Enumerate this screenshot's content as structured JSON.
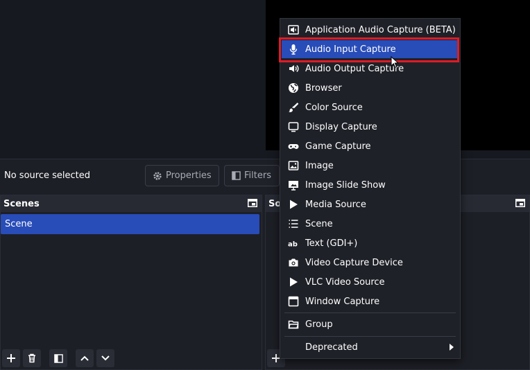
{
  "context_bar": {
    "no_source": "No source selected",
    "properties_label": "Properties",
    "filters_label": "Filters"
  },
  "scenes_dock": {
    "title": "Scenes",
    "items": [
      "Scene"
    ]
  },
  "sources_dock": {
    "title_partial": "So"
  },
  "menu": {
    "items": [
      {
        "label": "Application Audio Capture (BETA)",
        "icon": "app-audio-icon"
      },
      {
        "label": "Audio Input Capture",
        "icon": "microphone-icon",
        "selected": true
      },
      {
        "label": "Audio Output Capture",
        "icon": "speaker-icon"
      },
      {
        "label": "Browser",
        "icon": "globe-icon"
      },
      {
        "label": "Color Source",
        "icon": "paintbrush-icon"
      },
      {
        "label": "Display Capture",
        "icon": "monitor-icon"
      },
      {
        "label": "Game Capture",
        "icon": "gamepad-icon"
      },
      {
        "label": "Image",
        "icon": "image-icon"
      },
      {
        "label": "Image Slide Show",
        "icon": "slideshow-icon"
      },
      {
        "label": "Media Source",
        "icon": "play-icon"
      },
      {
        "label": "Scene",
        "icon": "list-icon"
      },
      {
        "label": "Text (GDI+)",
        "icon": "text-icon"
      },
      {
        "label": "Video Capture Device",
        "icon": "camera-icon"
      },
      {
        "label": "VLC Video Source",
        "icon": "play-icon"
      },
      {
        "label": "Window Capture",
        "icon": "window-icon"
      }
    ],
    "group_label": "Group",
    "deprecated_label": "Deprecated"
  },
  "colors": {
    "accent": "#284cb8",
    "highlight": "#e01b24"
  }
}
